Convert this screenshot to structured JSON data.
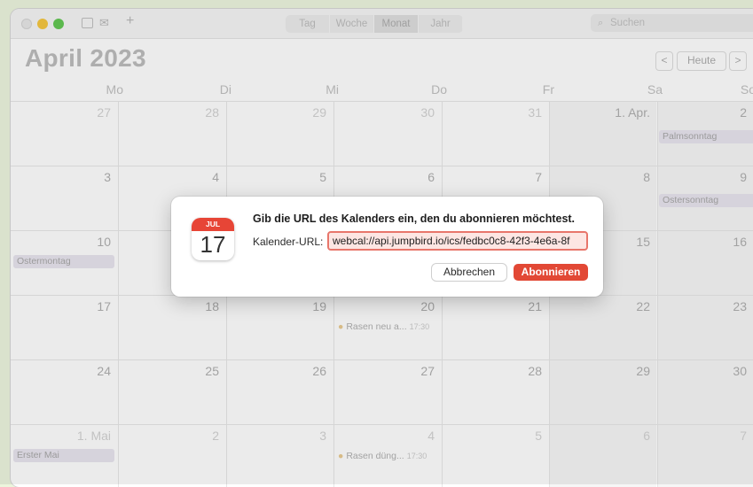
{
  "toolbar": {
    "views": [
      "Tag",
      "Woche",
      "Monat",
      "Jahr"
    ],
    "active_view": "Monat",
    "search_placeholder": "Suchen",
    "add_icon": "plus-icon",
    "calendars_icon": "calendar-list-icon",
    "inbox_icon": "inbox-icon"
  },
  "header": {
    "month_title": "April 2023",
    "prev": "<",
    "today": "Heute",
    "next": ">"
  },
  "weekdays": [
    "Mo",
    "Di",
    "Mi",
    "Do",
    "Fr",
    "Sa",
    "So"
  ],
  "weeks": [
    [
      "27",
      "28",
      "29",
      "30",
      "31",
      "1. Apr.",
      "2"
    ],
    [
      "3",
      "4",
      "5",
      "6",
      "7",
      "8",
      "9"
    ],
    [
      "10",
      "11",
      "12",
      "13",
      "14",
      "15",
      "16"
    ],
    [
      "17",
      "18",
      "19",
      "20",
      "21",
      "22",
      "23"
    ],
    [
      "24",
      "25",
      "26",
      "27",
      "28",
      "29",
      "30"
    ],
    [
      "1. Mai",
      "2",
      "3",
      "4",
      "5",
      "6",
      "7"
    ]
  ],
  "all_day_events": {
    "palmsonntag": "Palmsonntag",
    "ostersonntag": "Ostersonntag",
    "ostermontag": "Ostermontag",
    "erster_mai": "Erster Mai"
  },
  "timed_events": {
    "rasen_neu": {
      "title": "Rasen neu a...",
      "time": "17:30"
    },
    "rasen_dueng": {
      "title": "Rasen düng...",
      "time": "17:30"
    }
  },
  "dialog": {
    "icon_month": "JUL",
    "icon_day": "17",
    "title": "Gib die URL des Kalenders ein, den du abonnieren möchtest.",
    "url_label": "Kalender-URL:",
    "url_value": "webcal://api.jumpbird.io/ics/fedbc0c8-42f3-4e6a-8f",
    "cancel_label": "Abbrechen",
    "subscribe_label": "Abonnieren"
  },
  "colors": {
    "accent": "#e24835",
    "event_tint": "#e7e3ee",
    "background": "#ecf5dc"
  }
}
